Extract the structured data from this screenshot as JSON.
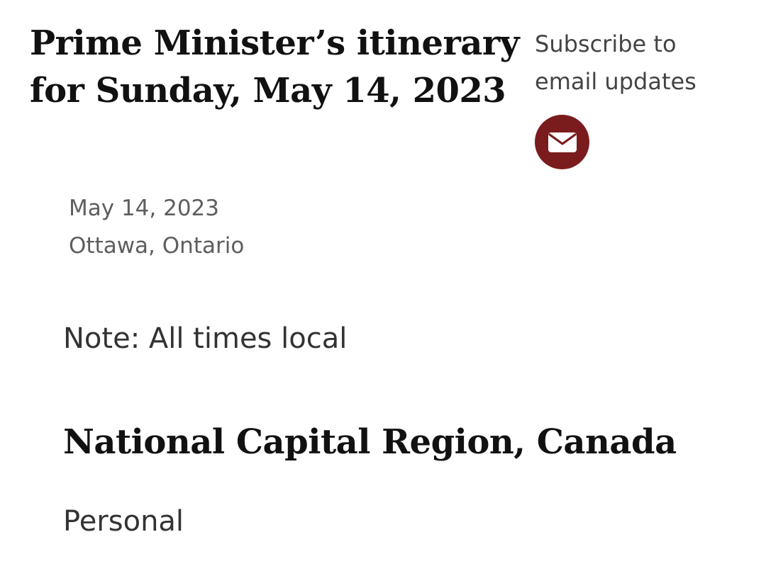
{
  "article": {
    "title": "Prime Minister’s itinerary for Sunday, May 14, 2023",
    "date": "May 14, 2023",
    "location": "Ottawa, Ontario",
    "note": "Note: All times local"
  },
  "subscribe": {
    "label": "Subscribe to email updates",
    "icon": "envelope-icon",
    "button_color": "#7a1c1d"
  },
  "itinerary": {
    "region": "National Capital Region, Canada",
    "first_item": "Personal"
  }
}
